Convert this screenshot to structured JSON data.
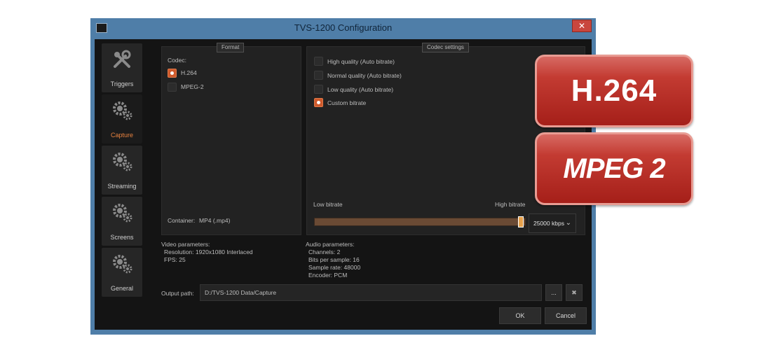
{
  "window": {
    "title": "TVS-1200 Configuration",
    "close_label": "✕"
  },
  "sidebar": {
    "items": [
      {
        "label": "Triggers",
        "icon": "tools-icon"
      },
      {
        "label": "Capture",
        "icon": "gears-icon",
        "active": true
      },
      {
        "label": "Streaming",
        "icon": "gears-icon"
      },
      {
        "label": "Screens",
        "icon": "gears-icon"
      },
      {
        "label": "General",
        "icon": "gears-icon"
      }
    ]
  },
  "format": {
    "tab_label": "Format",
    "codec_label": "Codec:",
    "options": [
      {
        "label": "H.264",
        "selected": true
      },
      {
        "label": "MPEG-2",
        "selected": false
      }
    ],
    "container_label": "Container:",
    "container_value": "MP4 (.mp4)"
  },
  "codec_settings": {
    "tab_label": "Codec settings",
    "options": [
      {
        "label": "High quality (Auto bitrate)",
        "selected": false
      },
      {
        "label": "Normal quality (Auto bitrate)",
        "selected": false
      },
      {
        "label": "Low quality (Auto bitrate)",
        "selected": false
      },
      {
        "label": "Custom bitrate",
        "selected": true
      }
    ],
    "low_label": "Low bitrate",
    "high_label": "High bitrate",
    "slider_fraction": 0.98,
    "bitrate_value": "25000 kbps",
    "bitrate_chevron": "⌄"
  },
  "video_params": {
    "heading": "Video parameters:",
    "resolution": "Resolution: 1920x1080 Interlaced",
    "fps": "FPS: 25"
  },
  "audio_params": {
    "heading": "Audio parameters:",
    "channels": "Channels: 2",
    "bits": "Bits per sample: 16",
    "rate": "Sample rate: 48000",
    "encoder": "Encoder: PCM"
  },
  "output": {
    "label": "Output path:",
    "path": "D:/TVS-1200 Data/Capture",
    "browse_label": "...",
    "clear_label": "✖"
  },
  "buttons": {
    "ok": "OK",
    "cancel": "Cancel"
  },
  "badges": {
    "h264": "H.264",
    "mpeg2": "MPEG 2"
  },
  "colors": {
    "accent": "#e8823f",
    "badge_red": "#c33b32",
    "titlebar": "#4f7ea8"
  }
}
